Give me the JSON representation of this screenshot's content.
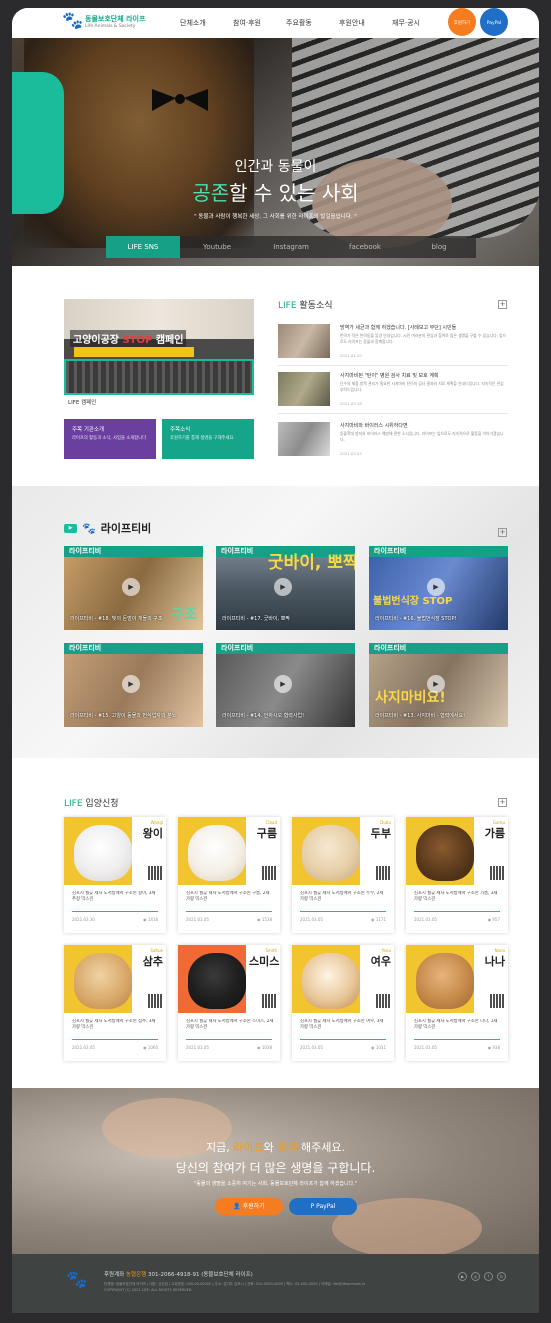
{
  "header": {
    "logo_title": "동물보호단체 라이프",
    "logo_sub": "Life Animals & Society",
    "nav": [
      "단체소개",
      "참여·후원",
      "주요활동",
      "후원안내",
      "재무·공시"
    ],
    "donate_label": "후원하기",
    "paypal_label": "PayPal",
    "colors": {
      "accent": "#1abc9c",
      "donate": "#f57c1f",
      "paypal": "#1f6fc6"
    }
  },
  "hero": {
    "line1": "인간과 동물이",
    "line2_highlight": "공존",
    "line2_rest": "할 수 있는 사회",
    "sub": "\" 동물과 사람이 행복한 세상, 그 사회를 위한 라이프의 발걸음입니다. \"",
    "sns_tabs": [
      "LIFE SNS",
      "Youtube",
      "Instagram",
      "facebook",
      "blog"
    ]
  },
  "activity": {
    "banner_title_pre": "고양이공장",
    "banner_title_stop": "STOP",
    "banner_title_post": "캠페인",
    "banner_caption": "LIFE 캠페인",
    "quick1_title": "주목 기관소개",
    "quick1_sub": "라이프의 활동과 소식, 사업을 소개합니다",
    "quick2_title": "주목소식",
    "quick2_sub": "후원하기를 통해 생명을 구해주세요",
    "news_title_pre": "LIFE",
    "news_title": "활동소식",
    "news": [
      {
        "title": "방역가 세균과 함께 하겠습니다. [사례보고 무단] 시민들",
        "body": "반려가 작은 반려동물 입양 안내입니다. 시민 여러분의 관심과 참여로 많은 생명을 구할 수 있습니다. 앞으로도 라이프는 동물과 함께합니다.",
        "date": "2021.04.20"
      },
      {
        "title": "사지마비된 \"탄이\" 병원 검사 치료 및 보호 계획",
        "body": "단수의 체중 방목 관리가 필요한 사지마비 탄이의 검사 결과와 치료 계획을 안내드립니다. 지속적인 관심 부탁드립니다.",
        "date": "2021.03.18"
      },
      {
        "title": "사지마비와 바이러스 시위하다면",
        "body": "동물학대 방지와 바이러스 예방에 관한 소식입니다. 라이프는 앞으로도 지속적으로 활동을 이어가겠습니다.",
        "date": "2021.03.03"
      }
    ]
  },
  "lifetv": {
    "title": "라이프티비",
    "header_label": "라이프티비",
    "videos": [
      {
        "cap": "라이프티비 - #18. 빛의 돈벌이 개들의 구조",
        "big": "구조"
      },
      {
        "cap": "라이프티비 - #17. 굿바이, 뽀짝",
        "big": "굿바이, 뽀짝"
      },
      {
        "cap": "라이프티비 - #16. 불법번식장 STOP!",
        "big": "불법번식장 STOP"
      },
      {
        "cap": "라이프티비 - #15. 고양이 동물과 번식업자의 분노",
        "big": ""
      },
      {
        "cap": "라이프티비 - #14. 인하시오 협력사업!",
        "big": ""
      },
      {
        "cap": "라이프티비 - #13. 사지마비 - 협력에서요!",
        "big": "사지마비요!"
      }
    ]
  },
  "adoption": {
    "title_pre": "LIFE",
    "title": "입양신청",
    "cards": [
      {
        "tag": "Wangi",
        "name": "왕이",
        "text": "김포시 월곶 세사 도서방에서 구조된 왕이, 3세 추정 믹스견",
        "date": "2021.03.30",
        "views": "1418"
      },
      {
        "tag": "Cloud",
        "name": "구름",
        "text": "김포시 월곶 세사 도서방에서 구조된 구름, 2세 가량 믹스견",
        "date": "2021.03.05",
        "views": "1538"
      },
      {
        "tag": "Dubu",
        "name": "두부",
        "text": "김포시 월곶 세사 도서방에서 구조된 두부, 2세 가량 믹스견",
        "date": "2021.03.05",
        "views": "1171"
      },
      {
        "tag": "Gareu",
        "name": "가름",
        "text": "김포시 월곶 세사 도서방에서 구조된 가름, 3세 가량 믹스견",
        "date": "2021.03.05",
        "views": "957"
      },
      {
        "tag": "Saltue",
        "name": "삼추",
        "text": "김포시 월곶 세사 도서방에서 구조된 삼추, 3세 가량 믹스견",
        "date": "2021.03.05",
        "views": "1060"
      },
      {
        "tag": "Smith",
        "name": "스미스",
        "text": "김포시 월곶 세사 도서방에서 구조된 스미스, 2세 가량 믹스견",
        "date": "2021.03.05",
        "views": "1038"
      },
      {
        "tag": "Yeou",
        "name": "여우",
        "text": "김포시 월곶 세사 도서방에서 구조된 여우, 3세 가량 믹스견",
        "date": "2021.03.05",
        "views": "1031"
      },
      {
        "tag": "Nana",
        "name": "나나",
        "text": "김포시 월곶 세사 도서방에서 구조된 나나, 1세 가량 믹스견",
        "date": "2021.03.05",
        "views": "938"
      }
    ]
  },
  "cta": {
    "line1_pre": "지금,",
    "line1_hl1": "라이프",
    "line1_mid": "와",
    "line1_hl2": "함께",
    "line1_post": "해주세요.",
    "line2": "당신의 참여가 더 많은 생명을 구합니다.",
    "line3": "\"동물의 생명을 소중히 여기는 사회, 동물보호단체 라이프가 함께 하겠습니다.\"",
    "donate": "후원하기",
    "paypal": "PayPal"
  },
  "footer": {
    "line1_pre": "후원계좌",
    "line1_bank": "농협은행",
    "line1_acct": "301-2066-4918-91 (동물보호단체 라이프)",
    "info": "단체명: 동물보호단체 라이프 | 대표: 심인섭 | 고유번호: 000-00-00000 | 주소: 경기도 김포시 | 전화: 010-0000-0000 | 팩스: 02-000-0000 | 이메일: life@lifeanimals.kr",
    "copyright": "COPYRIGHT (C) 2021 LIFE. ALL RIGHTS RESERVED."
  }
}
